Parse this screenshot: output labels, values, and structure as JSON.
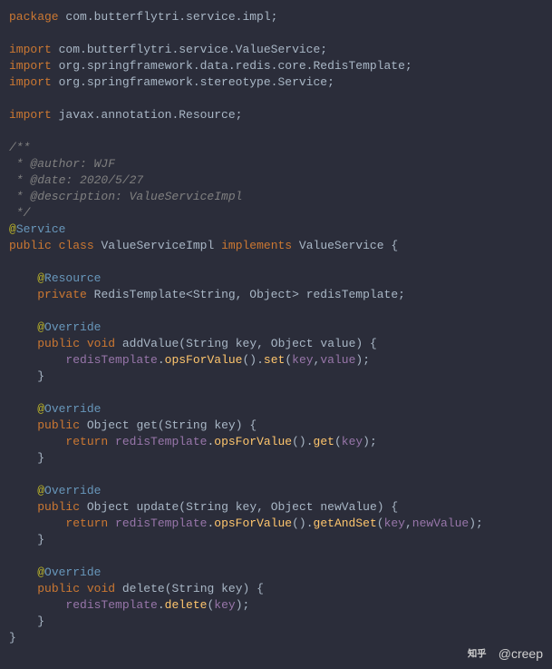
{
  "code": {
    "package_kw": "package",
    "package_name": "com.butterflytri.service.impl",
    "import_kw": "import",
    "import1": "com.butterflytri.service.ValueService",
    "import2": "org.springframework.data.redis.core.RedisTemplate",
    "import3": "org.springframework.stereotype.Service",
    "import4": "javax.annotation.Resource",
    "comment_start": "/**",
    "comment_author": " * @author: WJF",
    "comment_date": " * @date: 2020/5/27",
    "comment_desc": " * @description: ValueServiceImpl",
    "comment_end": " */",
    "at": "@",
    "ann_service": "Service",
    "ann_resource": "Resource",
    "ann_override": "Override",
    "public": "public",
    "class": "class",
    "void": "void",
    "private": "private",
    "return": "return",
    "implements": "implements",
    "classname": "ValueServiceImpl",
    "interface": "ValueService",
    "redis_type": "RedisTemplate<String, Object>",
    "redis_field": "redisTemplate",
    "m_add": "addValue",
    "m_get": "get",
    "m_update": "update",
    "m_delete": "delete",
    "ops": "opsForValue",
    "set": "set",
    "getcall": "get",
    "getandset": "getAndSet",
    "deletecall": "delete",
    "p_string": "String",
    "p_object": "Object",
    "p_key": "key",
    "p_value": "value",
    "p_newvalue": "newValue",
    "lbrace": "{",
    "rbrace": "}",
    "lparen": "(",
    "rparen": ")",
    "semi": ";",
    "comma": ",",
    "dot": ".",
    "space": " "
  },
  "watermark": {
    "text": "@creep",
    "zhihu_label": "知乎"
  }
}
